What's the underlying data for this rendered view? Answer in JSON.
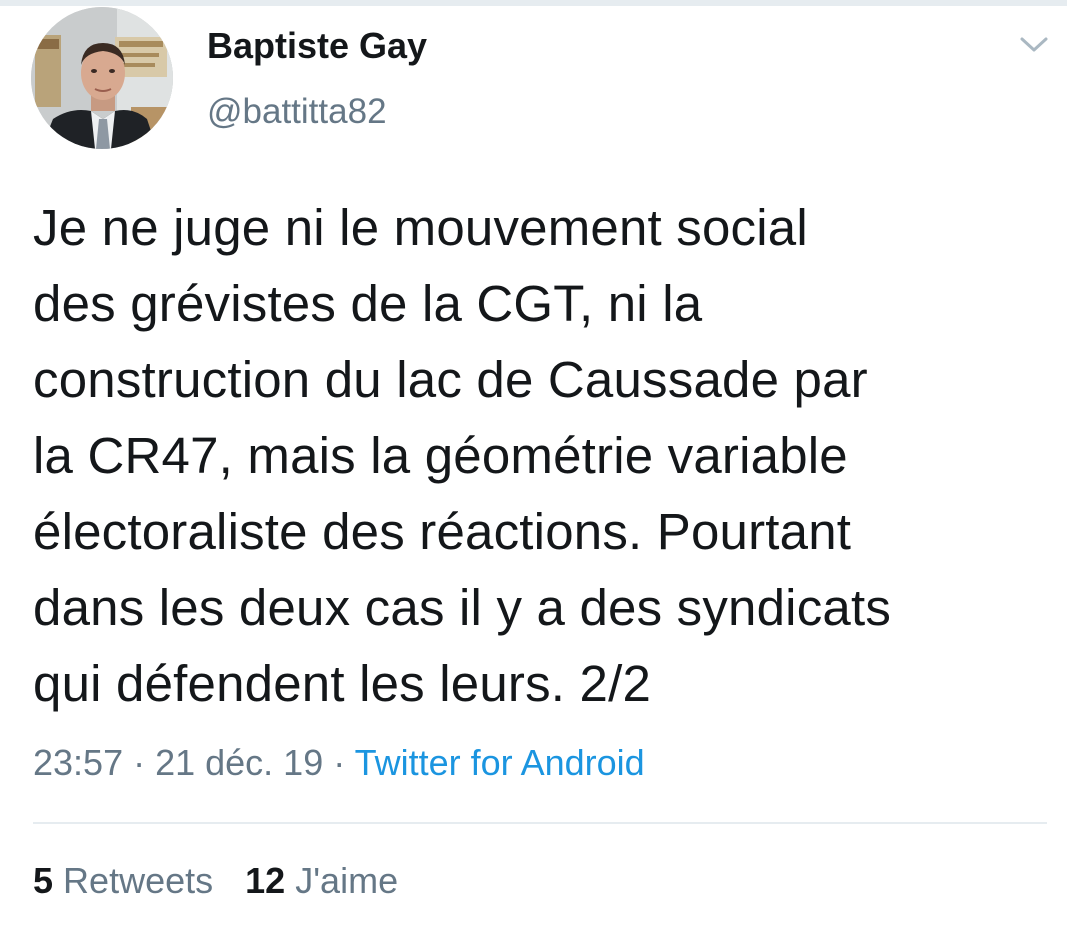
{
  "tweet": {
    "author": {
      "display_name": "Baptiste Gay",
      "handle": "@battitta82",
      "avatar_icon": "profile-photo"
    },
    "text": "Je ne juge ni le mouvement social\ndes grévistes de la CGT,  ni la\nconstruction du lac de Caussade par\nla CR47, mais la géométrie variable\nélectoraliste des réactions. Pourtant\ndans les deux cas il y a des syndicats\nqui défendent les leurs. 2/2",
    "time": "23:57",
    "separator": " · ",
    "date": "21 déc. 19",
    "source": "Twitter for Android",
    "stats": {
      "retweets_count": "5",
      "retweets_label": "Retweets",
      "likes_count": "12",
      "likes_label": "J'aime"
    },
    "menu_icon": "chevron-down-icon"
  },
  "colors": {
    "text_primary": "#14171a",
    "text_secondary": "#657786",
    "link": "#1b95e0",
    "divider": "#e6ecf0"
  }
}
